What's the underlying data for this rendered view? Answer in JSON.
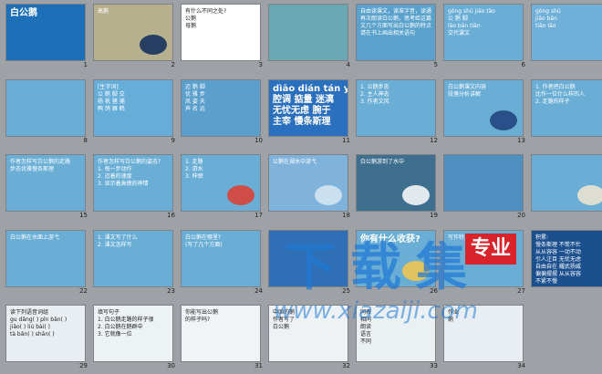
{
  "slides": [
    {
      "num": "1",
      "bg": "#1d6fb8",
      "lines": [
        "白公鹅"
      ]
    },
    {
      "num": "2",
      "bg": "#b7b08e",
      "lines": [
        "高鹅"
      ]
    },
    {
      "num": "3",
      "bg": "#ffffff",
      "lines": [
        "有什么不同之处?",
        "公鹅",
        "母鹅"
      ]
    },
    {
      "num": "4",
      "bg": "#6aa7b4",
      "lines": []
    },
    {
      "num": "5",
      "bg": "#5aa2cc",
      "lines": [
        "自由读课文，读准字音，读通",
        "再次朗读白公鹅，思考给这篇",
        "文几个方面写出白公鹅的特点",
        "请在书上画出相关语句"
      ]
    },
    {
      "num": "6",
      "bg": "#6aaed6",
      "lines": [
        "gōng  shū  jiǎo  tǎo",
        "公  鹅  脚",
        "lǎo  bān  tiān",
        "交代课文"
      ]
    },
    {
      "num": "7",
      "bg": "#70b0d8",
      "lines": [
        "gōng   shū",
        "jiǎo   bān",
        "tiān   lǎo"
      ]
    },
    {
      "num": "8",
      "bg": "#6aaed6",
      "lines": []
    },
    {
      "num": "9",
      "bg": "#66aed8",
      "lines": [
        "[生字词]",
        "公  鹅  脚  交",
        "杨  帆  猪  捕",
        "鸭  鸽  雁  鹤"
      ]
    },
    {
      "num": "10",
      "bg": "#5ba0cc",
      "lines": [
        "迈  鹅  脚",
        "优  雅  步",
        "凤  姿  天",
        "声  名  远"
      ]
    },
    {
      "num": "11",
      "bg": "#2b6fbf",
      "lines": [
        "dìāo   dián   tán yi",
        "腔调 掂量 迷漓",
        "无忧无虑 腕于",
        "主宰 慢条斯理"
      ]
    },
    {
      "num": "12",
      "bg": "#6aaed6",
      "lines": [
        "1. 公鹅步态",
        "2. 主人神态",
        "3. 作者文风"
      ]
    },
    {
      "num": "13",
      "bg": "#6aaed6",
      "lines": [
        "白公鹅课文内容",
        "段落分析讲解"
      ]
    },
    {
      "num": "14",
      "bg": "#6aaed6",
      "lines": [
        "1. 作者把白公鹅",
        "比作一位什么样的人",
        "2. 走路的样子"
      ]
    },
    {
      "num": "15",
      "bg": "#6aaed6",
      "lines": [
        "作者怎样写白公鹅的走路",
        "步态优雅慢条斯理"
      ]
    },
    {
      "num": "16",
      "bg": "#6aaed6",
      "lines": [
        "作者怎样写白公鹅的姿态?",
        "1. 每一步动作",
        "2. 迈着的速度",
        "3. 显示着高傲的神情"
      ]
    },
    {
      "num": "17",
      "bg": "#6aaed6",
      "lines": [
        "1. 走路",
        "2. 游水",
        "3. 伸颈"
      ]
    },
    {
      "num": "18",
      "bg": "#7fb3dc",
      "lines": [
        "公鹅在湖水中游弋"
      ]
    },
    {
      "num": "19",
      "bg": "#3e6f8e",
      "lines": [
        "白公鹅游到了水中"
      ]
    },
    {
      "num": "20",
      "bg": "#4f8fc0",
      "lines": []
    },
    {
      "num": "21",
      "bg": "#6aaed6",
      "lines": []
    },
    {
      "num": "22",
      "bg": "#6aaed6",
      "lines": [
        "白公鹅在水面上游弋"
      ]
    },
    {
      "num": "23",
      "bg": "#6aaed6",
      "lines": [
        "1. 课文写了什么",
        "2. 课文怎样写"
      ]
    },
    {
      "num": "24",
      "bg": "#6aaed6",
      "lines": [
        "白公鹅在哪里?",
        "(写了几个方面)"
      ]
    },
    {
      "num": "25",
      "bg": "#2f6fb5",
      "lines": []
    },
    {
      "num": "26",
      "bg": "#6aaed6",
      "lines": [
        "你有什么收获?"
      ]
    },
    {
      "num": "27",
      "bg": "#6aaed6",
      "lines": [
        "写作特点 抓住特点"
      ]
    },
    {
      "num": "28",
      "bg": "#1b4f8e",
      "lines": [
        "积累:",
        "慢条斯理  不慌不忙",
        "从从容容  一动不动",
        "引人注目  无忧无虑",
        "自由自在  耀武扬威",
        "偏偏摆摆  从从容容",
        "不紧不慢"
      ]
    },
    {
      "num": "29",
      "bg": "#e9eef2",
      "lines": [
        "读下列语音词组",
        "gu dǎng(  )  pǐn bǎn(  )",
        "jiǎo(   )  liú bài(   )",
        "tà bǎn(   )  shān(   )"
      ]
    },
    {
      "num": "30",
      "bg": "#edf2f5",
      "lines": [
        "填写句子",
        "1. 白公鹅走路的样子很",
        "2. 白公鹅在鹅群中",
        "3. 它就像一位"
      ]
    },
    {
      "num": "31",
      "bg": "#f0f4f6",
      "lines": [
        "你能写出公鹅",
        "的样子吗?"
      ]
    },
    {
      "num": "32",
      "bg": "#eef2f5",
      "lines": [
        "中国的鹅",
        "作者写了",
        "白公鹅"
      ]
    },
    {
      "num": "33",
      "bg": "#ebf0f3",
      "lines": [
        "同表",
        "相同",
        "朗读",
        "语言",
        "不同"
      ]
    },
    {
      "num": "34",
      "bg": "#e9eef2",
      "lines": [
        "作业",
        "鹅"
      ]
    }
  ],
  "watermark": {
    "title": "下载集",
    "subtitle": "专业",
    "url": "www.xiazaiji.com"
  }
}
